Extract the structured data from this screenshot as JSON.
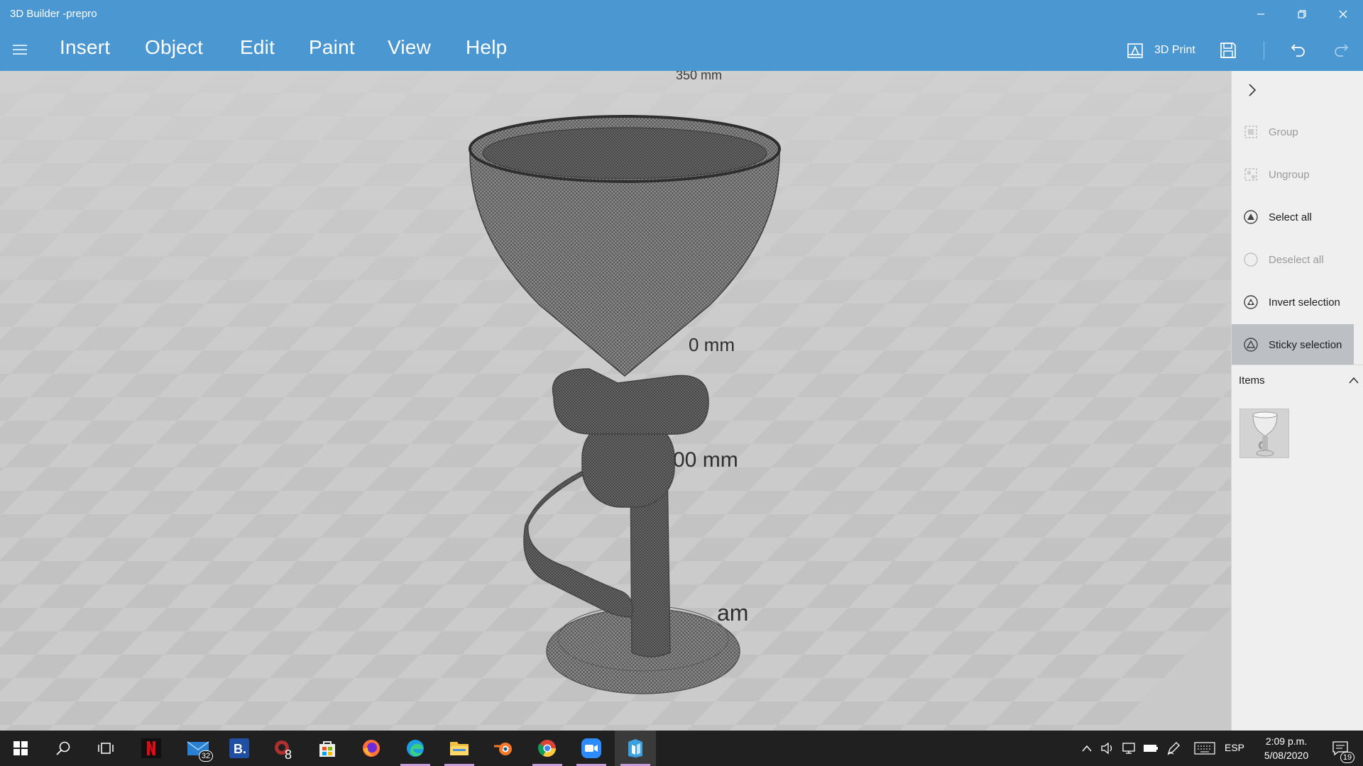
{
  "window": {
    "title": "3D Builder -prepro"
  },
  "menu": {
    "items": [
      "Insert",
      "Object",
      "Edit",
      "Paint",
      "View",
      "Help"
    ]
  },
  "toolbar": {
    "print_label": "3D Print",
    "icons": [
      "print-3d-icon",
      "save-icon",
      "undo-icon",
      "redo-icon"
    ]
  },
  "viewport": {
    "scale_labels": [
      "350 mm",
      "0 mm",
      "00 mm",
      "am"
    ],
    "model": "robot-vase-wireframe"
  },
  "panel": {
    "actions": [
      {
        "label": "Group",
        "icon": "group-icon",
        "state": "disabled"
      },
      {
        "label": "Ungroup",
        "icon": "ungroup-icon",
        "state": "disabled"
      },
      {
        "label": "Select all",
        "icon": "select-all-icon",
        "state": "enabled"
      },
      {
        "label": "Deselect all",
        "icon": "deselect-all-icon",
        "state": "disabled"
      },
      {
        "label": "Invert selection",
        "icon": "invert-selection-icon",
        "state": "enabled"
      },
      {
        "label": "Sticky selection",
        "icon": "sticky-selection-icon",
        "state": "active"
      }
    ],
    "items_header": "Items"
  },
  "taskbar": {
    "apps": [
      "start-icon",
      "search-icon",
      "task-view-icon",
      "netflix-icon",
      "mail-icon",
      "booking-icon",
      "app-icon",
      "store-icon",
      "firefox-icon",
      "edge-icon",
      "explorer-icon",
      "blender-icon",
      "chrome-icon",
      "zoom-icon",
      "3d-builder-icon"
    ],
    "mail_badge": "32",
    "app_badge": "8",
    "language": "ESP",
    "time": "2:09 p.m.",
    "date": "5/08/2020",
    "notifications_badge": "19"
  },
  "colors": {
    "accent": "#4a97d1",
    "panel_bg": "#efefef",
    "taskbar_bg": "#202020",
    "viewport_bg": "#c9c9c9"
  }
}
